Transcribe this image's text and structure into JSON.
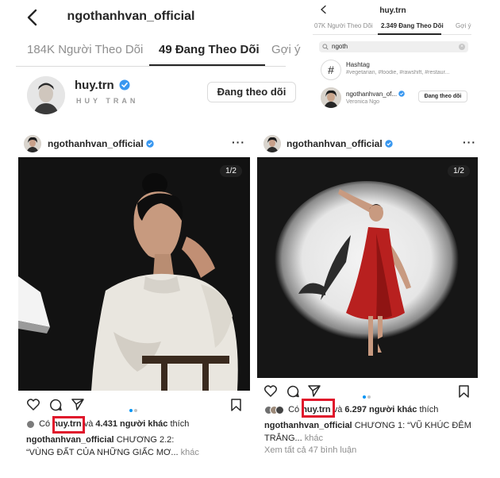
{
  "left_screen": {
    "title": "ngothanhvan_official",
    "tabs": [
      "184K Người Theo Dõi",
      "49 Đang Theo Dõi",
      "Gợi ý"
    ],
    "active_tab": 1,
    "account": {
      "username": "huy.trn",
      "verified": true,
      "handle_art": "HUY TRAN",
      "follow_button": "Đang theo dõi"
    }
  },
  "right_screen": {
    "title": "huy.trn",
    "tabs": [
      "07K Người Theo Dõi",
      "2.349 Đang Theo Dõi",
      "Gợi ý"
    ],
    "active_tab": 1,
    "search": {
      "value": "ngoth"
    },
    "results": [
      {
        "type": "hashtag",
        "title": "Hashtag",
        "subtitle": "#vegetarian, #foodie, #rawshift, #restaur..."
      },
      {
        "type": "account",
        "username": "ngothanhvan_of...",
        "verified": true,
        "full_name": "Veronica Ngo",
        "button": "Đang theo dõi"
      }
    ]
  },
  "post_left": {
    "author": "ngothanhvan_official",
    "verified": true,
    "more_icon": "···",
    "page_indicator": "1/2",
    "likes": {
      "prefix": "Có",
      "highlight_user": "huy.trn",
      "connector": "và",
      "count": "4.431 người khác",
      "suffix": "thích"
    },
    "caption": {
      "author": "ngothanhvan_official",
      "text_line1": "CHƯƠNG 2.2:",
      "text_line2": "“VÙNG ĐẤT CỦA NHỮNG GIẤC MƠ...",
      "more": "khác"
    },
    "photo_colors": {
      "background": "#121212",
      "shirt": "#e9e6df"
    }
  },
  "post_right": {
    "author": "ngothanhvan_official",
    "verified": true,
    "more_icon": "···",
    "page_indicator": "1/2",
    "likes": {
      "prefix": "Có",
      "highlight_user": "huy.trn",
      "connector": "và",
      "count": "6.297 người khác",
      "suffix": "thích"
    },
    "caption": {
      "author": "ngothanhvan_official",
      "text_line1": "CHƯƠNG 1: “VŨ KHÚC ĐÊM",
      "text_line2": "TRẮNG...",
      "more": "khác"
    },
    "comments_link": "Xem tất cả 47 bình luận",
    "photo_colors": {
      "background": "#161616",
      "spotlight": "#f2f2f2",
      "dress": "#b8201f"
    }
  },
  "colors": {
    "verified_blue": "#3897f0",
    "highlight_red": "#e0162b",
    "active_dot": "#0095f6"
  }
}
